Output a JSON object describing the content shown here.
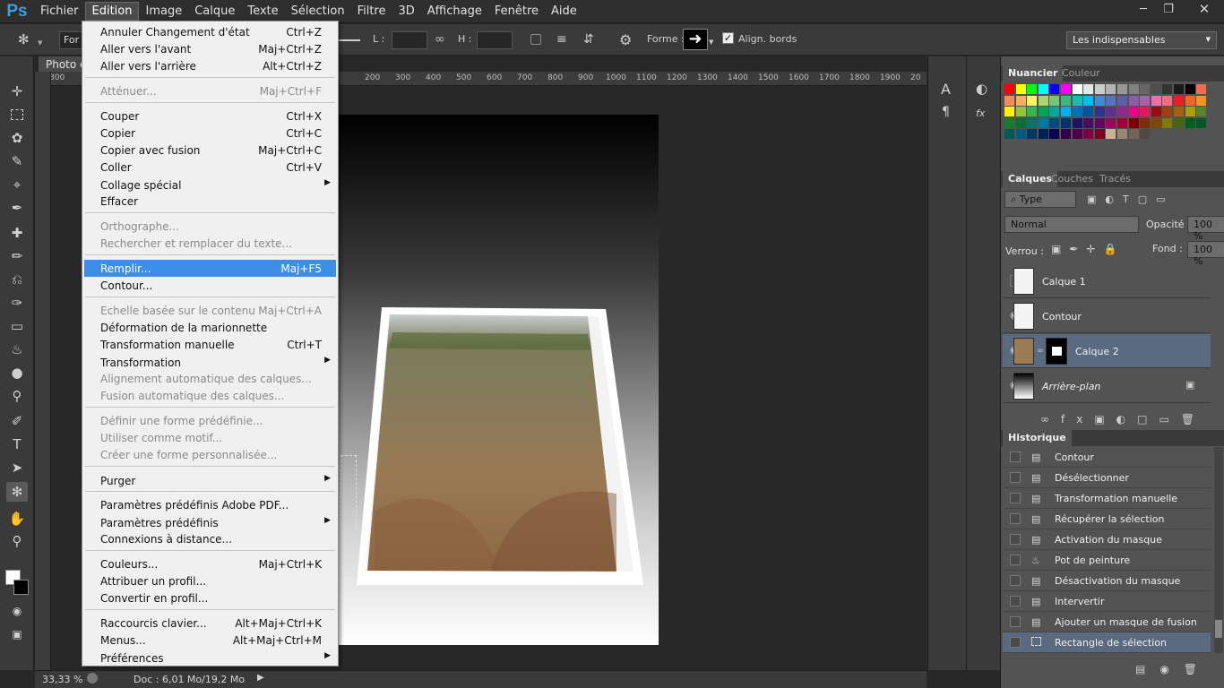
{
  "app": {
    "logo": "Ps"
  },
  "menubar": {
    "items": [
      "Fichier",
      "Edition",
      "Image",
      "Calque",
      "Texte",
      "Sélection",
      "Filtre",
      "3D",
      "Affichage",
      "Fenêtre",
      "Aide"
    ],
    "window_controls": [
      "minimize-icon",
      "restore-icon",
      "close-icon"
    ]
  },
  "options": {
    "tool_preset": "For",
    "width_label": "L :",
    "height_label": "H :",
    "shape_label": "Forme :",
    "align_edges": "Align. bords",
    "workspace": "Les indispensables"
  },
  "document": {
    "tab_title": "Photo é",
    "ruler_ticks": [
      "800",
      "200",
      "300",
      "400",
      "500",
      "600",
      "700",
      "800",
      "900",
      "1000",
      "1100",
      "1200",
      "1300",
      "1400",
      "1500",
      "1600",
      "1700",
      "1800",
      "1900",
      "20"
    ],
    "zoom": "33,33 %",
    "doc_size": "Doc : 6,01 Mo/19,2 Mo"
  },
  "edit_menu": {
    "items": [
      {
        "label": "Annuler Changement d'état",
        "shortcut": "Ctrl+Z",
        "disabled": false
      },
      {
        "label": "Aller vers l'avant",
        "shortcut": "Maj+Ctrl+Z",
        "disabled": false
      },
      {
        "label": "Aller vers l'arrière",
        "shortcut": "Alt+Ctrl+Z",
        "disabled": false
      },
      {
        "label": "Atténuer...",
        "shortcut": "Maj+Ctrl+F",
        "disabled": true
      },
      {
        "label": "Couper",
        "shortcut": "Ctrl+X",
        "disabled": false
      },
      {
        "label": "Copier",
        "shortcut": "Ctrl+C",
        "disabled": false
      },
      {
        "label": "Copier avec fusion",
        "shortcut": "Maj+Ctrl+C",
        "disabled": false
      },
      {
        "label": "Coller",
        "shortcut": "Ctrl+V",
        "disabled": false
      },
      {
        "label": "Collage spécial",
        "shortcut": "",
        "disabled": false,
        "submenu": true
      },
      {
        "label": "Effacer",
        "shortcut": "",
        "disabled": false
      },
      {
        "label": "Orthographe...",
        "shortcut": "",
        "disabled": true
      },
      {
        "label": "Rechercher et remplacer du texte...",
        "shortcut": "",
        "disabled": true
      },
      {
        "label": "Remplir...",
        "shortcut": "Maj+F5",
        "disabled": false,
        "highlighted": true
      },
      {
        "label": "Contour...",
        "shortcut": "",
        "disabled": false
      },
      {
        "label": "Echelle basée sur le contenu",
        "shortcut": "Maj+Ctrl+A",
        "disabled": true
      },
      {
        "label": "Déformation de la marionnette",
        "shortcut": "",
        "disabled": false
      },
      {
        "label": "Transformation manuelle",
        "shortcut": "Ctrl+T",
        "disabled": false
      },
      {
        "label": "Transformation",
        "shortcut": "",
        "disabled": false,
        "submenu": true
      },
      {
        "label": "Alignement automatique des calques...",
        "shortcut": "",
        "disabled": true
      },
      {
        "label": "Fusion automatique des calques...",
        "shortcut": "",
        "disabled": true
      },
      {
        "label": "Définir une forme prédéfinie...",
        "shortcut": "",
        "disabled": true
      },
      {
        "label": "Utiliser comme motif...",
        "shortcut": "",
        "disabled": true
      },
      {
        "label": "Créer une forme personnalisée...",
        "shortcut": "",
        "disabled": true
      },
      {
        "label": "Purger",
        "shortcut": "",
        "disabled": false,
        "submenu": true
      },
      {
        "label": "Paramètres prédéfinis Adobe PDF...",
        "shortcut": "",
        "disabled": false
      },
      {
        "label": "Paramètres prédéfinis",
        "shortcut": "",
        "disabled": false,
        "submenu": true
      },
      {
        "label": "Connexions à distance...",
        "shortcut": "",
        "disabled": false
      },
      {
        "label": "Couleurs...",
        "shortcut": "Maj+Ctrl+K",
        "disabled": false
      },
      {
        "label": "Attribuer un profil...",
        "shortcut": "",
        "disabled": false
      },
      {
        "label": "Convertir en profil...",
        "shortcut": "",
        "disabled": false
      },
      {
        "label": "Raccourcis clavier...",
        "shortcut": "Alt+Maj+Ctrl+K",
        "disabled": false
      },
      {
        "label": "Menus...",
        "shortcut": "Alt+Maj+Ctrl+M",
        "disabled": false
      },
      {
        "label": "Préférences",
        "shortcut": "",
        "disabled": false,
        "submenu": true
      }
    ]
  },
  "swatches_panel": {
    "tabs": [
      "Nuancier",
      "Couleur"
    ]
  },
  "layers_panel": {
    "tabs": [
      "Calques",
      "Couches",
      "Tracés"
    ],
    "filter": "Type",
    "blend_mode": "Normal",
    "opacity_label": "Opacité :",
    "opacity": "100 %",
    "lock_label": "Verrou :",
    "fill_label": "Fond :",
    "fill": "100 %",
    "layers": [
      {
        "name": "Calque 1",
        "visible": false,
        "selected": false
      },
      {
        "name": "Contour",
        "visible": true,
        "selected": false
      },
      {
        "name": "Calque 2",
        "visible": true,
        "selected": true
      },
      {
        "name": "Arrière-plan",
        "visible": true,
        "selected": false,
        "locked": true
      }
    ]
  },
  "history_panel": {
    "title": "Historique",
    "items": [
      {
        "name": "Contour",
        "icon": "doc-icon"
      },
      {
        "name": "Désélectionner",
        "icon": "doc-icon"
      },
      {
        "name": "Transformation manuelle",
        "icon": "doc-icon"
      },
      {
        "name": "Récupérer la sélection",
        "icon": "doc-icon"
      },
      {
        "name": "Activation du masque",
        "icon": "doc-icon"
      },
      {
        "name": "Pot de peinture",
        "icon": "bucket-icon"
      },
      {
        "name": "Désactivation du masque",
        "icon": "doc-icon"
      },
      {
        "name": "Intervertir",
        "icon": "doc-icon"
      },
      {
        "name": "Ajouter un masque de fusion",
        "icon": "doc-icon"
      },
      {
        "name": "Rectangle de sélection",
        "icon": "marquee-icon",
        "selected": true
      }
    ]
  },
  "colors": {
    "accent": "#3d8ee6",
    "panel": "#535353",
    "selected_row": "#5a6a80"
  }
}
